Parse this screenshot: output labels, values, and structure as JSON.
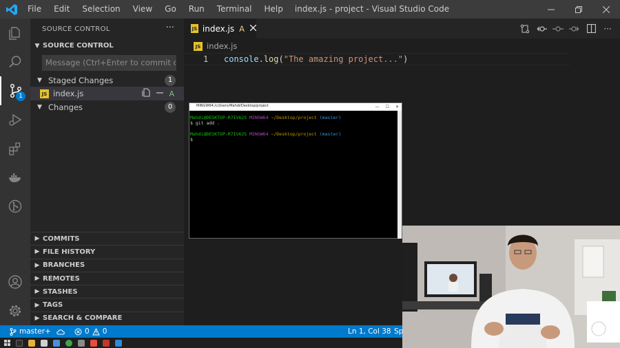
{
  "window": {
    "title": "index.js - project - Visual Studio Code"
  },
  "menu": [
    "File",
    "Edit",
    "Selection",
    "View",
    "Go",
    "Run",
    "Terminal",
    "Help"
  ],
  "activity_bar": {
    "items": [
      "explorer-icon",
      "search-icon",
      "source-control-icon",
      "run-debug-icon",
      "extensions-icon",
      "docker-icon",
      "git-graph-icon"
    ],
    "source_control_badge": "1",
    "bottom": [
      "account-icon",
      "settings-gear-icon"
    ]
  },
  "sidebar": {
    "title": "SOURCE CONTROL",
    "section_title": "SOURCE CONTROL",
    "commit_placeholder": "Message (Ctrl+Enter to commit on '...",
    "staged": {
      "label": "Staged Changes",
      "count": "1"
    },
    "staged_file": {
      "name": "index.js",
      "status": "A"
    },
    "changes": {
      "label": "Changes",
      "count": "0"
    },
    "bottom_sections": [
      "COMMITS",
      "FILE HISTORY",
      "BRANCHES",
      "REMOTES",
      "STASHES",
      "TAGS",
      "SEARCH & COMPARE"
    ]
  },
  "editor": {
    "tab": {
      "label": "index.js",
      "status": "A"
    },
    "breadcrumb": "index.js",
    "line_number": "1",
    "code": {
      "obj": "console",
      "dot": ".",
      "fn": "log",
      "open": "(",
      "str": "\"The amazing project...\"",
      "close": ")"
    }
  },
  "terminal": {
    "title": "MINGW64:/c/Users/Mahdi/Desktop/project",
    "lines": [
      {
        "user": "Mahdi@DESKTOP-R7IV62S",
        "host": "MINGW64",
        "path": "~/Desktop/project",
        "branch": "(master)"
      },
      {
        "cmd": "$ git add ."
      },
      {
        "user": "Mahdi@DESKTOP-R7IV62S",
        "host": "MINGW64",
        "path": "~/Desktop/project",
        "branch": "(master)"
      },
      {
        "cmd": "$"
      }
    ]
  },
  "status_bar": {
    "branch": "master+",
    "errors": "0",
    "warnings": "0",
    "position": "Ln 1, Col 38",
    "spaces": "Sp"
  },
  "colors": {
    "accent": "#007acc",
    "activity_bar": "#333333",
    "sidebar": "#252526",
    "editor": "#1e1e1e"
  }
}
